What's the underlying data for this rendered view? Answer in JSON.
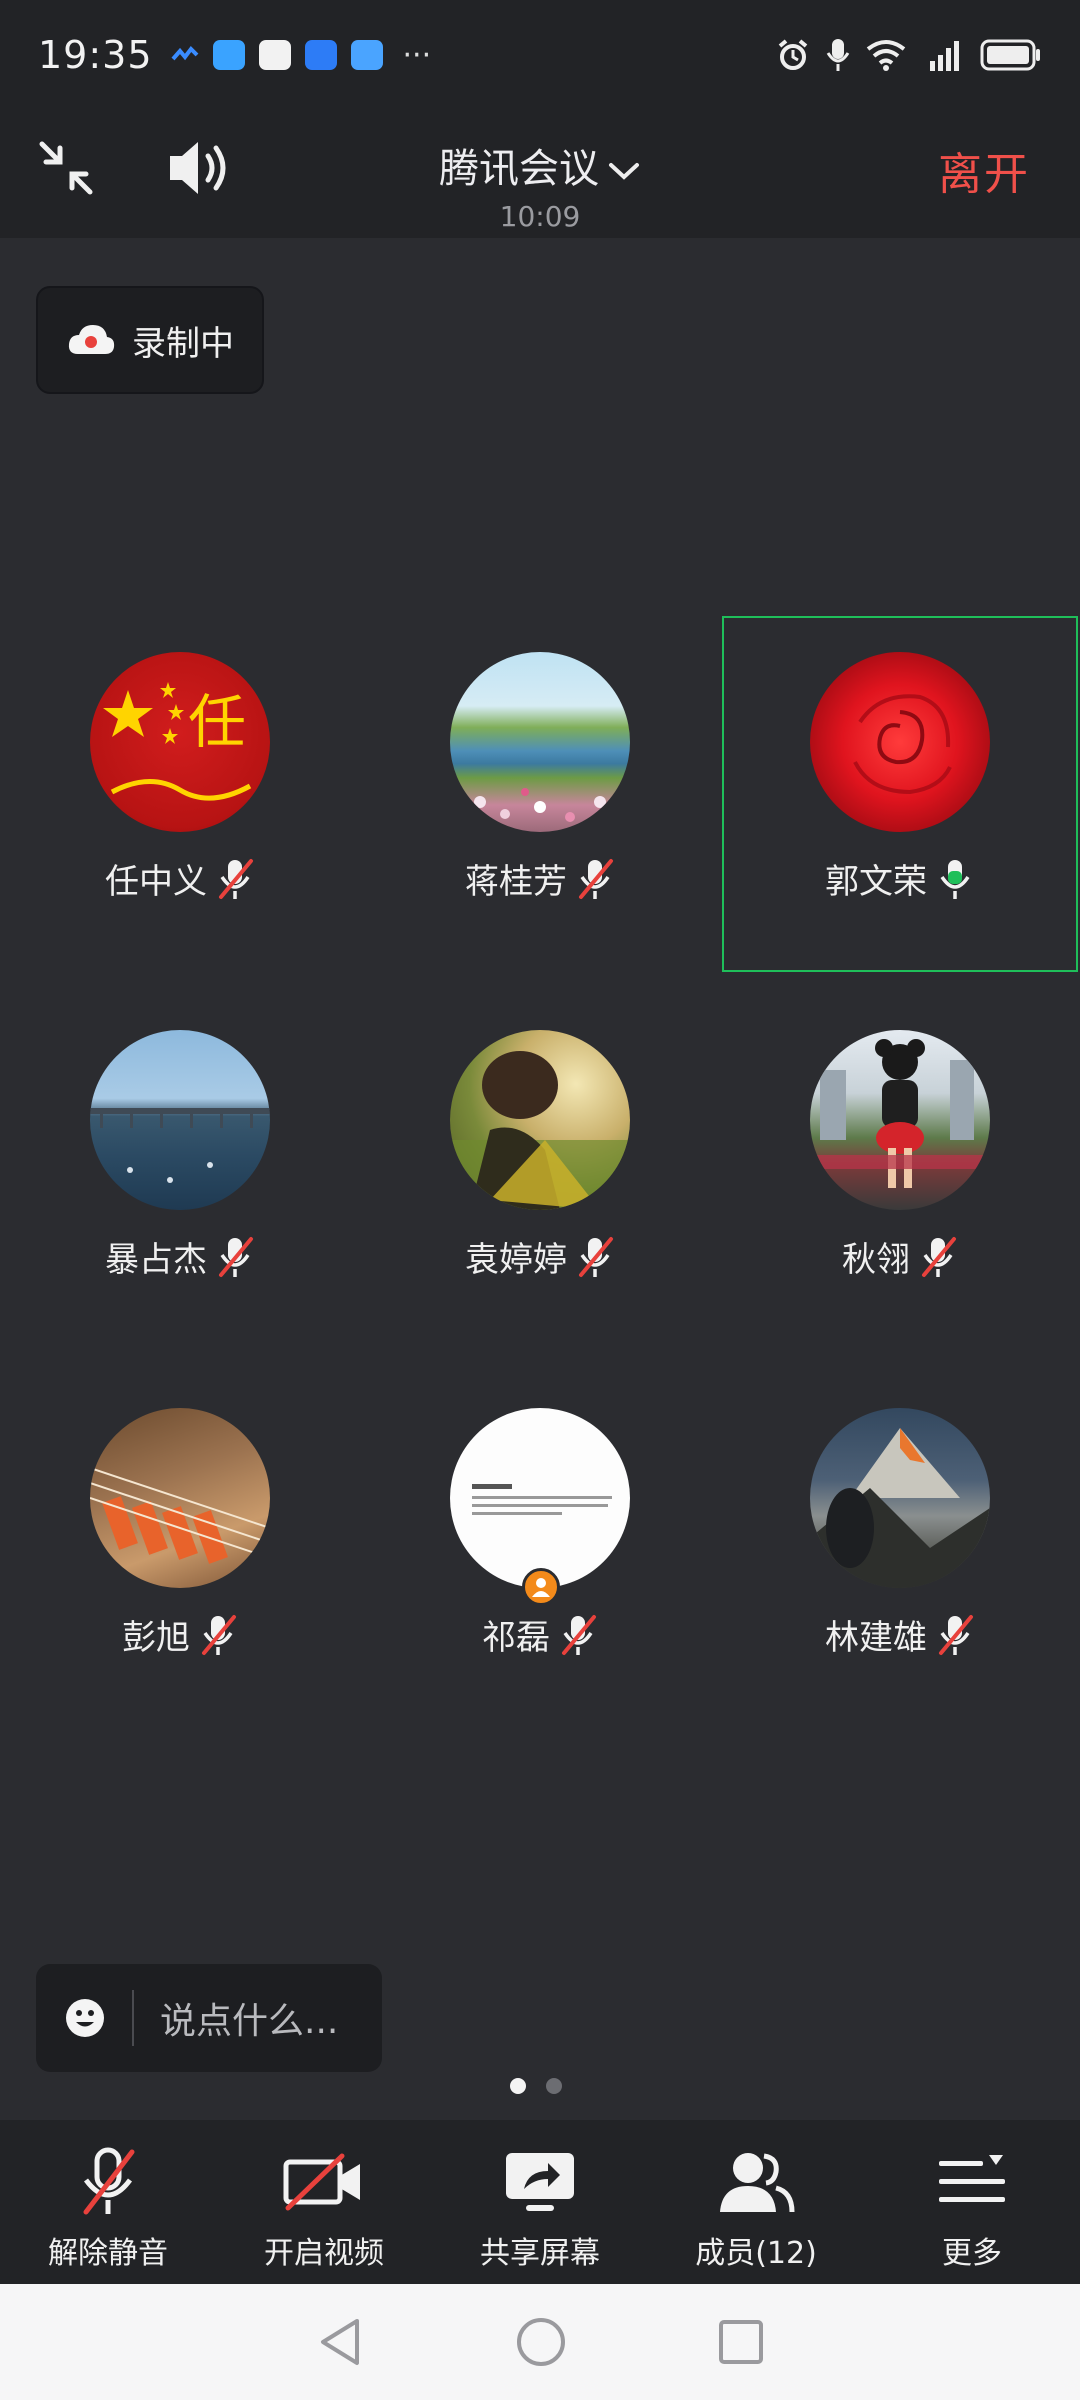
{
  "status_bar": {
    "time": "19:35",
    "more": "···"
  },
  "top_bar": {
    "title": "腾讯会议",
    "duration": "10:09",
    "leave_label": "离开"
  },
  "recording": {
    "label": "录制中"
  },
  "participants": [
    {
      "name": "任中义",
      "mic": "muted",
      "avatar_text": "任"
    },
    {
      "name": "蒋桂芳",
      "mic": "muted"
    },
    {
      "name": "郭文荣",
      "mic": "speaking"
    },
    {
      "name": "暴占杰",
      "mic": "muted"
    },
    {
      "name": "袁婷婷",
      "mic": "muted"
    },
    {
      "name": "秋翎",
      "mic": "muted"
    },
    {
      "name": "彭旭",
      "mic": "muted"
    },
    {
      "name": "祁磊",
      "mic": "muted"
    },
    {
      "name": "林建雄",
      "mic": "muted"
    }
  ],
  "chat": {
    "placeholder": "说点什么..."
  },
  "pager": {
    "pages": 2,
    "current": 1
  },
  "toolbar": {
    "unmute": "解除静音",
    "start_video": "开启视频",
    "share_screen": "共享屏幕",
    "members": "成员(12)",
    "more": "更多"
  },
  "colors": {
    "background": "#2b2c30",
    "bar": "#222326",
    "leave": "#f0504a",
    "speaking": "#1fbf5a",
    "mute_slash": "#e8413c"
  }
}
